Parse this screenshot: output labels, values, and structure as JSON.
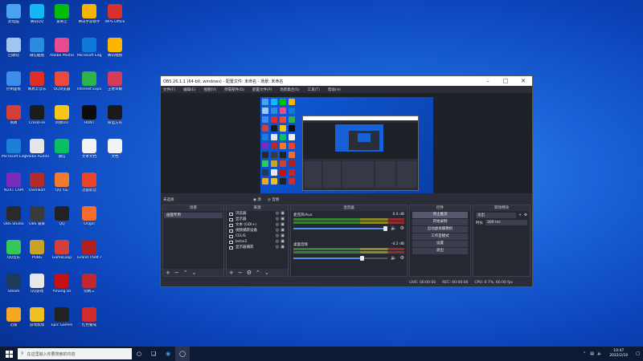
{
  "desktop": {
    "columns": [
      [
        {
          "label": "此电脑",
          "color": "#4aa3f0"
        },
        {
          "label": "回收站",
          "color": "#9ec6ee"
        },
        {
          "label": "控制面板",
          "color": "#3d8ee8"
        },
        {
          "label": "网易",
          "color": "#d43f3a"
        },
        {
          "label": "Microsoft Edge",
          "color": "#1b7fd6"
        },
        {
          "label": "NZXT CAM",
          "color": "#7b2cbf"
        },
        {
          "label": "OBS Studio",
          "color": "#2a2a2a"
        },
        {
          "label": "QQ音乐",
          "color": "#34c759"
        },
        {
          "label": "Steam",
          "color": "#1b3a5c"
        },
        {
          "label": "迅雷",
          "color": "#f5a623"
        }
      ],
      [
        {
          "label": "腾讯QQ",
          "color": "#12b7f5"
        },
        {
          "label": "微信截图",
          "color": "#2b8be0"
        },
        {
          "label": "网易云音乐",
          "color": "#e02e24"
        },
        {
          "label": "CrossFire",
          "color": "#1c1c1c"
        },
        {
          "label": "Adobe Audition",
          "color": "#e6e6e6"
        },
        {
          "label": "Overwolf",
          "color": "#b22a2a"
        },
        {
          "label": "OBS 录屏",
          "color": "#3a3a3a"
        },
        {
          "label": "PUBG",
          "color": "#c9a227"
        },
        {
          "label": "QQ游戏",
          "color": "#e8e8e8"
        },
        {
          "label": "游戏加加",
          "color": "#f0c020"
        }
      ],
      [
        {
          "label": "爱奇艺",
          "color": "#00be06"
        },
        {
          "label": "Adobe Photoshop",
          "color": "#e94b8e"
        },
        {
          "label": "QQ浏览器",
          "color": "#ec4b3c"
        },
        {
          "label": "网易UU",
          "color": "#f5c518"
        },
        {
          "label": "微信",
          "color": "#07c160"
        },
        {
          "label": "QQ飞车",
          "color": "#f07b2b"
        },
        {
          "label": "QQ",
          "color": "#222222"
        },
        {
          "label": "GameLoop",
          "color": "#d43f3a"
        },
        {
          "label": "Among Us",
          "color": "#c51111"
        },
        {
          "label": "Epic Games",
          "color": "#222222"
        }
      ],
      [
        {
          "label": "腾讯手游助手",
          "color": "#f5b400"
        },
        {
          "label": "Microsoft Edge",
          "color": "#0f7ad8"
        },
        {
          "label": "Internet Explorer",
          "color": "#2db34a"
        },
        {
          "label": "HUNT",
          "color": "#0c0c0c"
        },
        {
          "label": "文本文档",
          "color": "#f2f2f2"
        },
        {
          "label": "迅雷影音",
          "color": "#e8452c"
        },
        {
          "label": "Origin",
          "color": "#f56c2d"
        },
        {
          "label": "Grand Theft Auto",
          "color": "#b0201f"
        },
        {
          "label": "剑网三",
          "color": "#c0282d"
        },
        {
          "label": "红色警戒",
          "color": "#d12c2c"
        }
      ],
      [
        {
          "label": "WPS Office",
          "color": "#d9302c"
        },
        {
          "label": "腾讯视频",
          "color": "#ffb400"
        },
        {
          "label": "王者荣耀",
          "color": "#d83a5a"
        },
        {
          "label": "命运方舟",
          "color": "#1a1a1a"
        },
        {
          "label": "文档",
          "color": "#f2f2f2"
        }
      ]
    ]
  },
  "obs": {
    "title": "OBS 26.1.1 (64-bit, windows) - 配置文件: 未命名 - 场景: 未命名",
    "menu": [
      "文件(F)",
      "编辑(E)",
      "视图(V)",
      "停靠部件(D)",
      "配置文件(P)",
      "场景集合(S)",
      "工具(T)",
      "帮助(H)"
    ],
    "scene_mode": "未选择",
    "radio_a": "源",
    "radio_b": "音频",
    "scenes": {
      "header": "场景",
      "items": [
        "画面专用"
      ]
    },
    "sources": {
      "header": "来源",
      "items": [
        "浏览器",
        "显示器",
        "文本 (GDI+)",
        "视频捕获设备",
        "CELIS",
        "bstar2",
        "显示器捕获"
      ]
    },
    "mixer": {
      "header": "混音器",
      "channels": [
        {
          "name": "麦克风/Aux",
          "db": "0.0 dB"
        },
        {
          "name": "桌面音频",
          "db": "-4.2 dB"
        }
      ]
    },
    "controls": {
      "header": "控件",
      "buttons": [
        "停止推流",
        "开始录制",
        "启动虚拟摄像机",
        "工作室模式",
        "设置",
        "退出"
      ]
    },
    "transitions": {
      "header": "转场特效",
      "type": "淡出",
      "duration_label": "时长",
      "duration": "300 ms"
    },
    "status": {
      "live": "LIVE: 00:00:00",
      "rec": "REC: 00:00:00",
      "cpu": "CPU: 0.7%, 60.00 fps"
    }
  },
  "taskbar": {
    "search_placeholder": "在这里输入你要搜索的内容",
    "time": "10:47",
    "date": "2022/2/10"
  }
}
